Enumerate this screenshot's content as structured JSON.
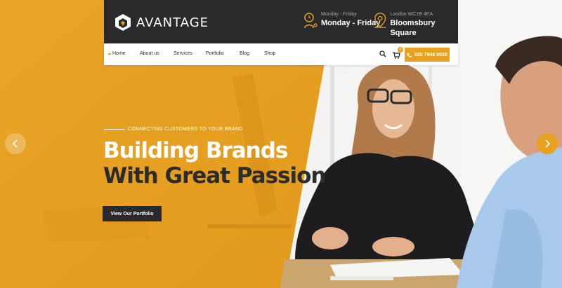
{
  "brand": {
    "name": "AVANTAGE"
  },
  "header": {
    "hours": {
      "small": "Monday - Friday",
      "big": "Monday - Friday",
      "icon": "clock-person-icon"
    },
    "location": {
      "small": "London WC1B 4EA",
      "big": "Bloomsbury Square",
      "icon": "map-pin-icon"
    }
  },
  "nav": {
    "items": [
      "Home",
      "About us",
      "Services",
      "Portfolio",
      "Blog",
      "Shop"
    ],
    "cart_count": "0",
    "phone": "020 7946 0020"
  },
  "hero": {
    "tagline": "CONNECTING CUSTOMERS TO YOUR BRAND",
    "headline_line1": "Building Brands",
    "headline_line2": "With Great Passion",
    "cta": "View Our Portfolio"
  },
  "colors": {
    "accent": "#e8a120",
    "dark": "#2a2a2c"
  }
}
